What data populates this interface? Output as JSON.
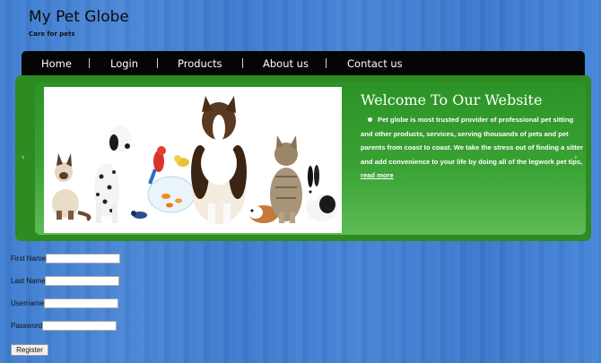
{
  "header": {
    "site_title": "My Pet Globe",
    "tagline": "Care for pets"
  },
  "nav": {
    "items": [
      {
        "label": "Home"
      },
      {
        "label": "Login"
      },
      {
        "label": "Products"
      },
      {
        "label": "About us"
      },
      {
        "label": "Contact us"
      }
    ]
  },
  "slider": {
    "prev_icon": "‹",
    "next_icon": "›",
    "title": "Welcome To Our Website",
    "text": "Pet globe is most trusted provider of professional pet sitting and other products, services, serving thousands of pets and pet parents from coast to coast. We take the stress out of finding a sitter and add convenience to your life by doing all of the legwork pet tips, .",
    "read_more": "read more",
    "image_icon": "pets-group-image"
  },
  "form": {
    "first_name_label": "First Name",
    "last_name_label": "Last Name",
    "username_label": "Username",
    "password_label": "Password",
    "first_name_value": "",
    "last_name_value": "",
    "username_value": "",
    "password_value": "",
    "register_label": "Register"
  },
  "colors": {
    "nav_bg": "#050505",
    "slider_green": "#2e8b22",
    "page_blue": "#4583d5"
  }
}
